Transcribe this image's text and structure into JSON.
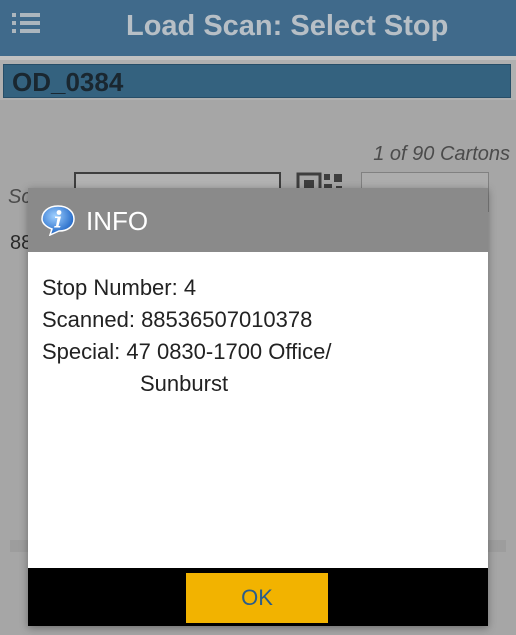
{
  "app_bar": {
    "title": "Load Scan: Select Stop",
    "menu_icon": "menu-list-icon"
  },
  "order": {
    "id": "OD_0384"
  },
  "scan_panel": {
    "carton_count": "1 of 90 Cartons",
    "scan_label_fragment": "Sc",
    "scanned_value_fragment": "88",
    "qr_icon": "qr-code-icon"
  },
  "dialog": {
    "title": "INFO",
    "icon": "info-icon",
    "lines": [
      "Stop Number: 4",
      "Scanned: 88536507010378",
      "Special: 47 0830-1700  Office/",
      "Sunburst"
    ],
    "ok_label": "OK"
  },
  "colors": {
    "app_bar": "#4d7fa6",
    "order_bar": "#3f7598",
    "dialog_header": "#8a8a8a",
    "ok_button": "#f2b300",
    "ok_text": "#2a5d8a"
  }
}
